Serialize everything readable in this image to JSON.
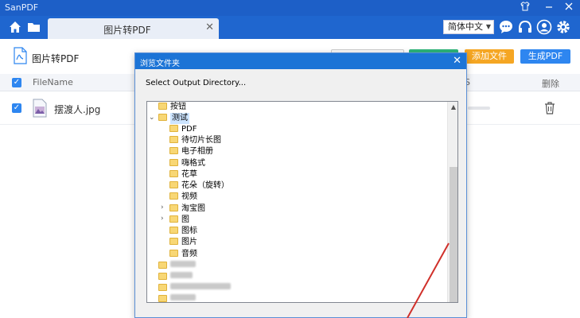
{
  "app": {
    "name": "SanPDF"
  },
  "tab": {
    "label": "图片转PDF"
  },
  "language": {
    "selected": "简体中文"
  },
  "page": {
    "title": "图片转PDF",
    "add_file_label": "添加文件",
    "generate_pdf_label": "生成PDF"
  },
  "table": {
    "columns": {
      "filename": "FileName",
      "delete": "删除",
      "size": "S"
    },
    "rows": [
      {
        "name": "摆渡人.jpg"
      }
    ]
  },
  "dialog": {
    "title": "浏览文件夹",
    "prompt": "Select Output Directory...",
    "tree": [
      {
        "label": "按钮"
      },
      {
        "label": "测试"
      },
      {
        "label": "PDF"
      },
      {
        "label": "待切片长图"
      },
      {
        "label": "电子相册"
      },
      {
        "label": "嗨格式"
      },
      {
        "label": "花草"
      },
      {
        "label": "花朵（旋转）"
      },
      {
        "label": "视频"
      },
      {
        "label": "淘宝图"
      },
      {
        "label": "图"
      },
      {
        "label": "图标"
      },
      {
        "label": "图片"
      },
      {
        "label": "音频"
      }
    ]
  },
  "colors": {
    "accent": "#1f66cf",
    "orange": "#f5a623",
    "blue": "#2e86f0",
    "arrow": "#d0302a"
  }
}
